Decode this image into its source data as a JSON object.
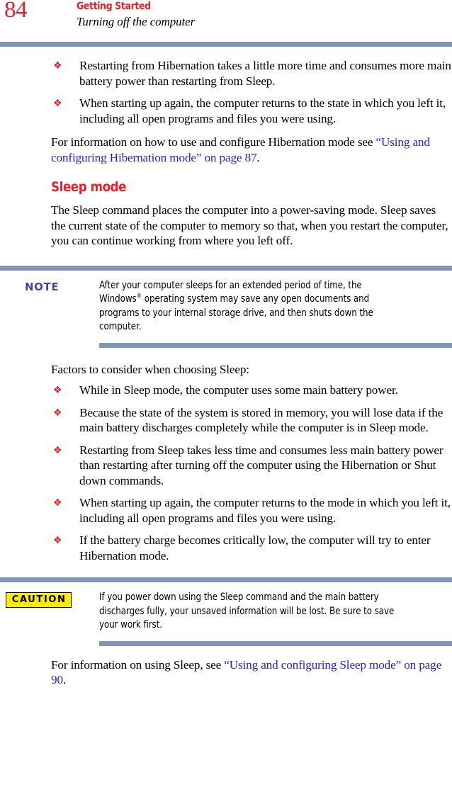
{
  "header": {
    "page_number": "84",
    "chapter": "Getting Started",
    "section": "Turning off the computer"
  },
  "colors": {
    "accent_red": "#ee1c25",
    "rule_blue": "#7d97b5",
    "link_blue": "#2222dd",
    "note_purple": "#5a3d9e",
    "caution_yellow": "#ffed00"
  },
  "bullet_glyph": "❖",
  "hibernation_bullets": [
    "Restarting from Hibernation takes a little more time and consumes more main battery power than restarting from Sleep.",
    "When starting up again, the computer returns to the state in which you left it, including all open programs and files you were using."
  ],
  "hibernation_xref": {
    "lead_in": "For information on how to use and configure Hibernation mode see ",
    "link_text": "“Using and configuring Hibernation mode” on page 87",
    "tail": "."
  },
  "sleep_mode": {
    "heading": "Sleep mode",
    "intro": "The Sleep command places the computer into a power-saving mode. Sleep saves the current state of the computer to memory so that, when you restart the computer, you can continue working from where you left off."
  },
  "note": {
    "label": "NOTE",
    "body_before_sup": "After your computer sleeps for an extended period of time, the Windows",
    "superscript": "®",
    "body_after_sup": " operating system may save any open documents and programs to your internal storage drive, and then shuts down the computer."
  },
  "factors": {
    "lead_in": "Factors to consider when choosing Sleep:",
    "bullets": [
      "While in Sleep mode, the computer uses some main battery power.",
      "Because the state of the system is stored in memory, you will lose data if the main battery discharges completely while the computer is in Sleep mode.",
      "Restarting from Sleep takes less time and consumes less main battery power than restarting after turning off the computer using the Hibernation or Shut down commands.",
      "When starting up again, the computer returns to the mode in which you left it, including all open programs and files you were using.",
      "If the battery charge becomes critically low, the computer will try to enter Hibernation mode."
    ]
  },
  "caution": {
    "label": "CAUTION",
    "body": "If you power down using the Sleep command and the main battery discharges fully, your unsaved information will be lost. Be sure to save your work first."
  },
  "sleep_xref": {
    "lead_in": "For information on using Sleep, see ",
    "link_text": "“Using and configuring Sleep mode” on page 90",
    "tail": "."
  }
}
